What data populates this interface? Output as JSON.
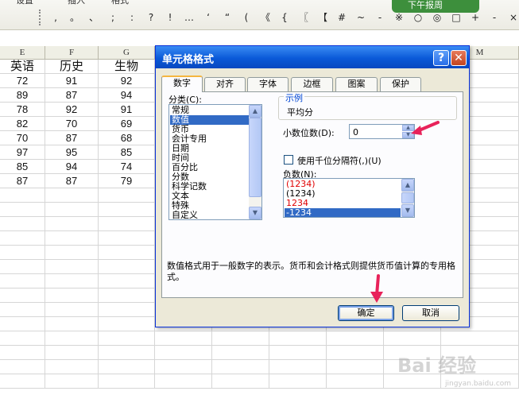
{
  "toolbar": {
    "top_text": [
      "设置",
      "插入",
      "格式"
    ],
    "symbols": [
      ",",
      "。",
      "、",
      ";",
      ":",
      "?",
      "!",
      "…",
      "‘",
      "“",
      "(",
      "《",
      "{",
      "〖",
      "【",
      "#",
      "~",
      "-",
      "※",
      "○",
      "◎",
      "□",
      "+",
      "-",
      "×",
      "÷"
    ],
    "green_text": "下午报周"
  },
  "sheet": {
    "columns": [
      "E",
      "F",
      "G",
      "",
      "",
      "",
      "",
      "",
      "M"
    ],
    "headers": [
      "英语",
      "历史",
      "生物"
    ],
    "rows": [
      [
        "72",
        "91",
        "92"
      ],
      [
        "89",
        "87",
        "94"
      ],
      [
        "78",
        "92",
        "91"
      ],
      [
        "82",
        "70",
        "69"
      ],
      [
        "70",
        "87",
        "68"
      ],
      [
        "97",
        "95",
        "85"
      ],
      [
        "85",
        "94",
        "74"
      ],
      [
        "87",
        "87",
        "79"
      ]
    ]
  },
  "dialog": {
    "title": "单元格格式",
    "help": "?",
    "close": "✕",
    "tabs": [
      "数字",
      "对齐",
      "字体",
      "边框",
      "图案",
      "保护"
    ],
    "category_label": "分类(C):",
    "categories": [
      "常规",
      "数值",
      "货币",
      "会计专用",
      "日期",
      "时间",
      "百分比",
      "分数",
      "科学记数",
      "文本",
      "特殊",
      "自定义"
    ],
    "selected_category": 1,
    "sample_label": "示例",
    "sample_value": "平均分",
    "decimal_label": "小数位数(D):",
    "decimal_value": "0",
    "thousands_label": "使用千位分隔符(,)(U)",
    "negative_label": "负数(N):",
    "negative_options": [
      "(1234)",
      "(1234)",
      "1234",
      "-1234"
    ],
    "negative_red": [
      true,
      false,
      true,
      false
    ],
    "selected_negative": 3,
    "description": "数值格式用于一般数字的表示。货币和会计格式则提供货币值计算的专用格式。",
    "ok_label": "确定",
    "cancel_label": "取消"
  },
  "watermark": {
    "main": "Bai 经验",
    "sub": "jingyan.baidu.com"
  },
  "colors": {
    "title_bar": "#0a59d8",
    "selection": "#316ac5",
    "annotation_arrow": "#e8225a",
    "dialog_face": "#ece9d8"
  }
}
